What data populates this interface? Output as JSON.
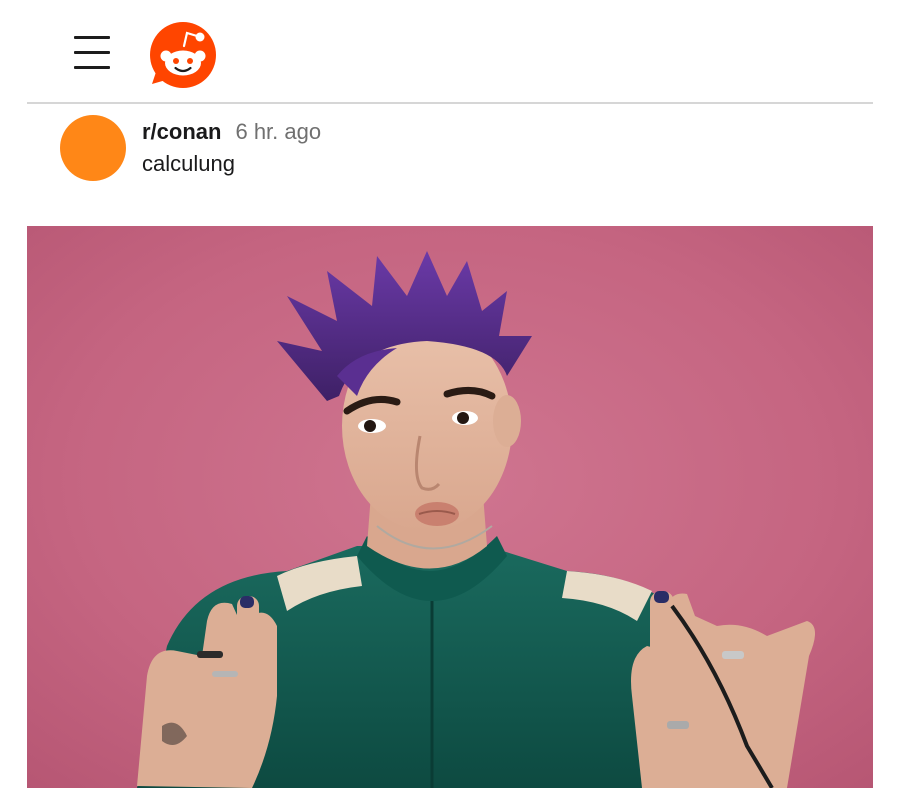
{
  "app": {
    "brand_color": "#ff4500",
    "icons": {
      "menu": "hamburger-menu-icon",
      "logo": "reddit-snoo-logo"
    }
  },
  "post": {
    "subreddit": "r/conan",
    "time_ago": "6 hr. ago",
    "author": "calculung",
    "avatar_color": "#ff8717",
    "image": {
      "content": "man with spiky purple hair in green track jacket making a pouting face against a pink wall",
      "background_color": "#c86882"
    }
  }
}
